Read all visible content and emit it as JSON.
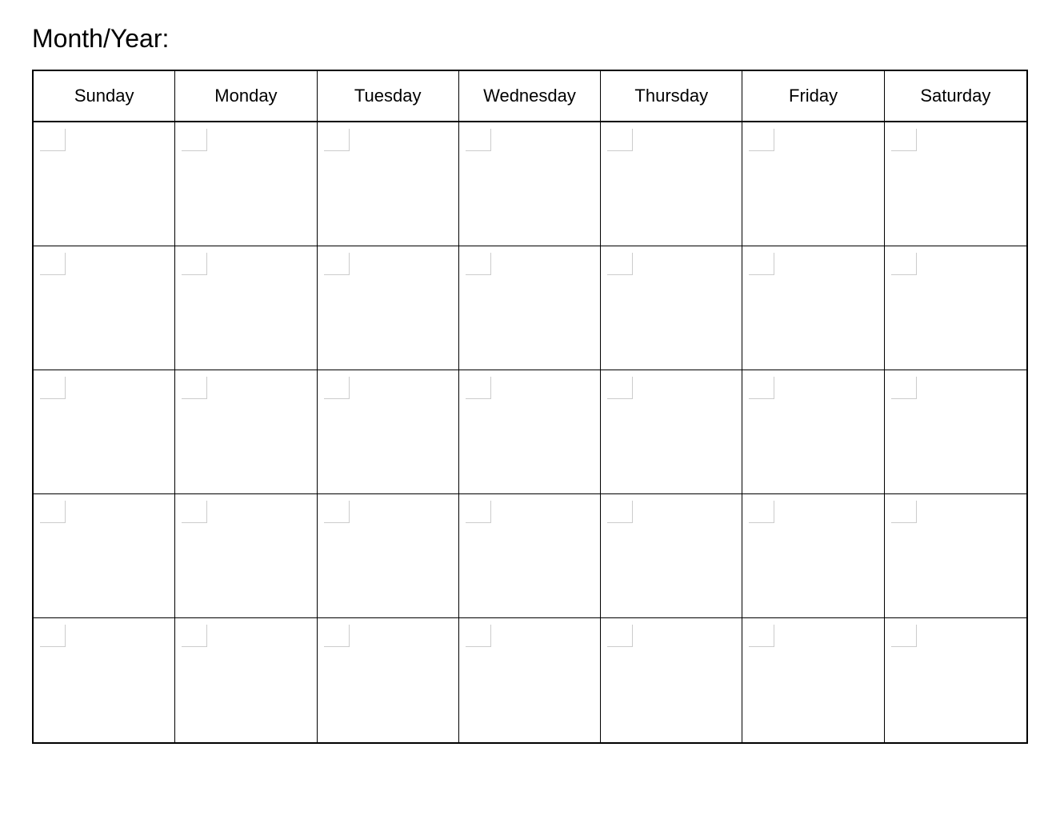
{
  "header": {
    "title": "Month/Year:"
  },
  "calendar": {
    "days": [
      "Sunday",
      "Monday",
      "Tuesday",
      "Wednesday",
      "Thursday",
      "Friday",
      "Saturday"
    ],
    "weeks": 5,
    "cells_per_week": 7
  }
}
